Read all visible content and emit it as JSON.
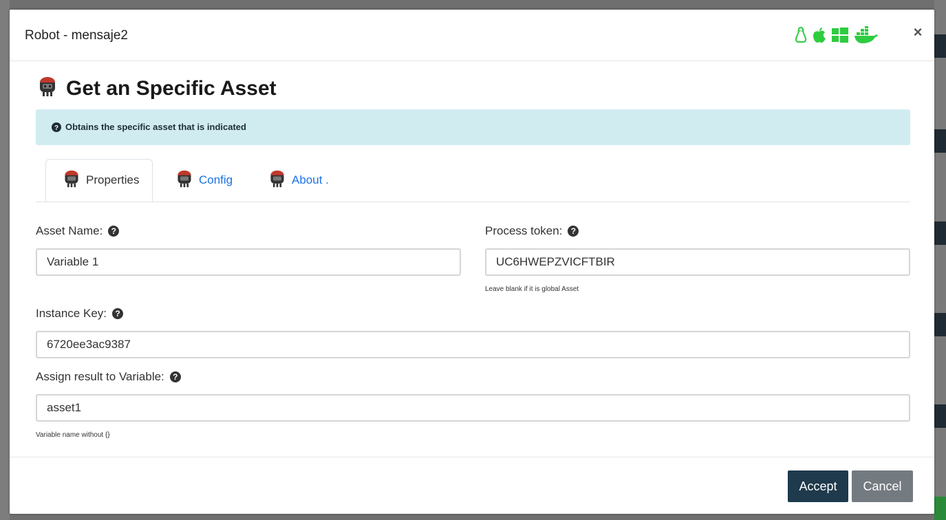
{
  "modal": {
    "title": "Robot - mensaje2",
    "os_icons": [
      "linux-icon",
      "apple-icon",
      "windows-icon",
      "docker-icon"
    ],
    "os_icon_color": "#2ecc40",
    "close_label": "×"
  },
  "heading": {
    "icon": "robot-icon",
    "title": "Get an Specific Asset"
  },
  "info": {
    "icon": "question-circle-icon",
    "text": "Obtains the specific asset that is indicated",
    "background": "#d1ecf1"
  },
  "tabs": [
    {
      "label": "Properties",
      "active": true
    },
    {
      "label": "Config",
      "active": false
    },
    {
      "label": "About .",
      "active": false
    }
  ],
  "form": {
    "asset_name": {
      "label": "Asset Name:",
      "value": "Variable 1"
    },
    "process_token": {
      "label": "Process token:",
      "value": "UC6HWEPZVICFTBIR",
      "hint": "Leave blank if it is global Asset"
    },
    "instance_key": {
      "label": "Instance Key:",
      "value": "6720ee3ac9387"
    },
    "assign_result": {
      "label": "Assign result to Variable:",
      "value": "asset1",
      "hint": "Variable name without {}"
    }
  },
  "footer": {
    "accept_label": "Accept",
    "cancel_label": "Cancel",
    "accept_color": "#1e3a4c",
    "cancel_color": "#737a80"
  }
}
